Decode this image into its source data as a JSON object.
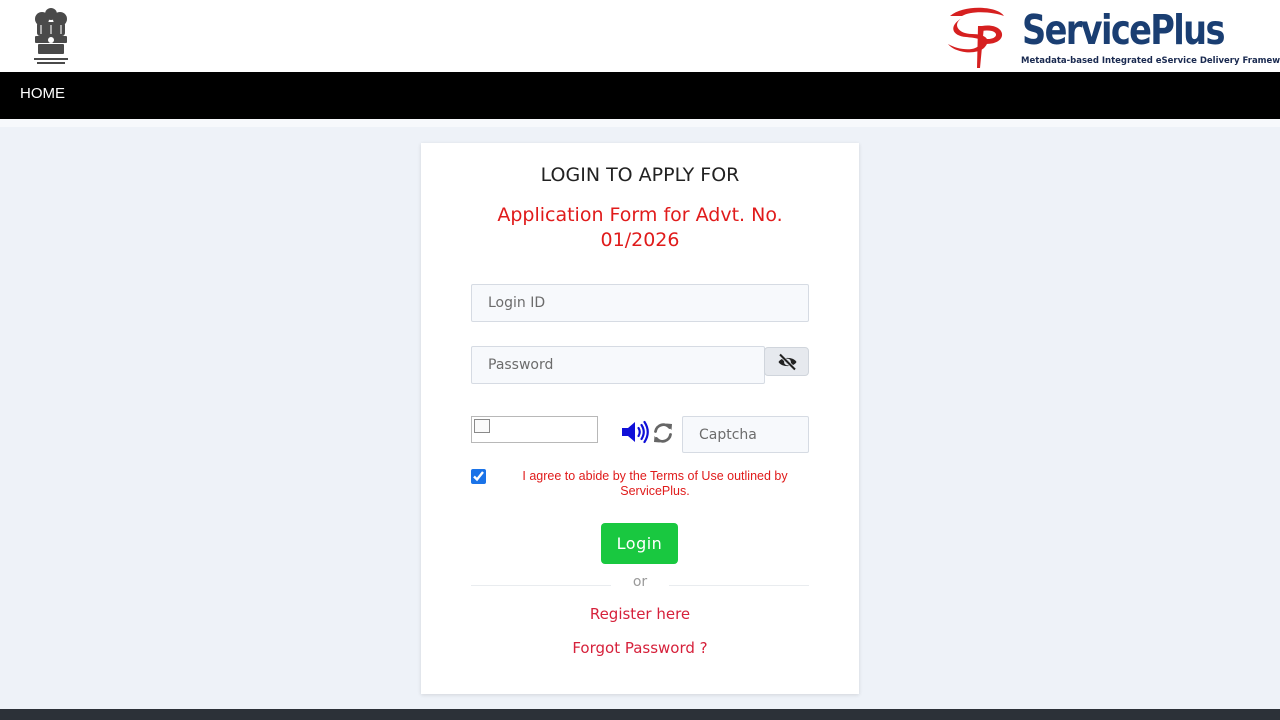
{
  "header": {
    "brand_name": "ServicePlus",
    "brand_tagline": "Metadata-based Integrated eService Delivery Framework",
    "emblem_icon": "national-emblem-icon",
    "logo_icon": "serviceplus-sp-logo-icon"
  },
  "nav": {
    "home_label": "HOME"
  },
  "login": {
    "heading": "LOGIN TO APPLY FOR",
    "form_title": "Application Form for Advt. No. 01/2026",
    "login_id_placeholder": "Login ID",
    "password_placeholder": "Password",
    "captcha_placeholder": "Captcha",
    "show_password_icon": "eye-slash-icon",
    "audio_icon": "speaker-icon",
    "refresh_icon": "refresh-icon",
    "terms_checked": true,
    "terms_text": "I agree to abide by the Terms of Use outlined by ServicePlus.",
    "login_button": "Login",
    "or_text": "or",
    "register_link": "Register here",
    "forgot_link": "Forgot Password ?"
  },
  "colors": {
    "accent_red": "#e01b1b",
    "link_red": "#d6213b",
    "login_green": "#19c840",
    "brand_blue": "#1a3e72",
    "nav_black": "#000000",
    "audio_blue": "#1010d8"
  }
}
